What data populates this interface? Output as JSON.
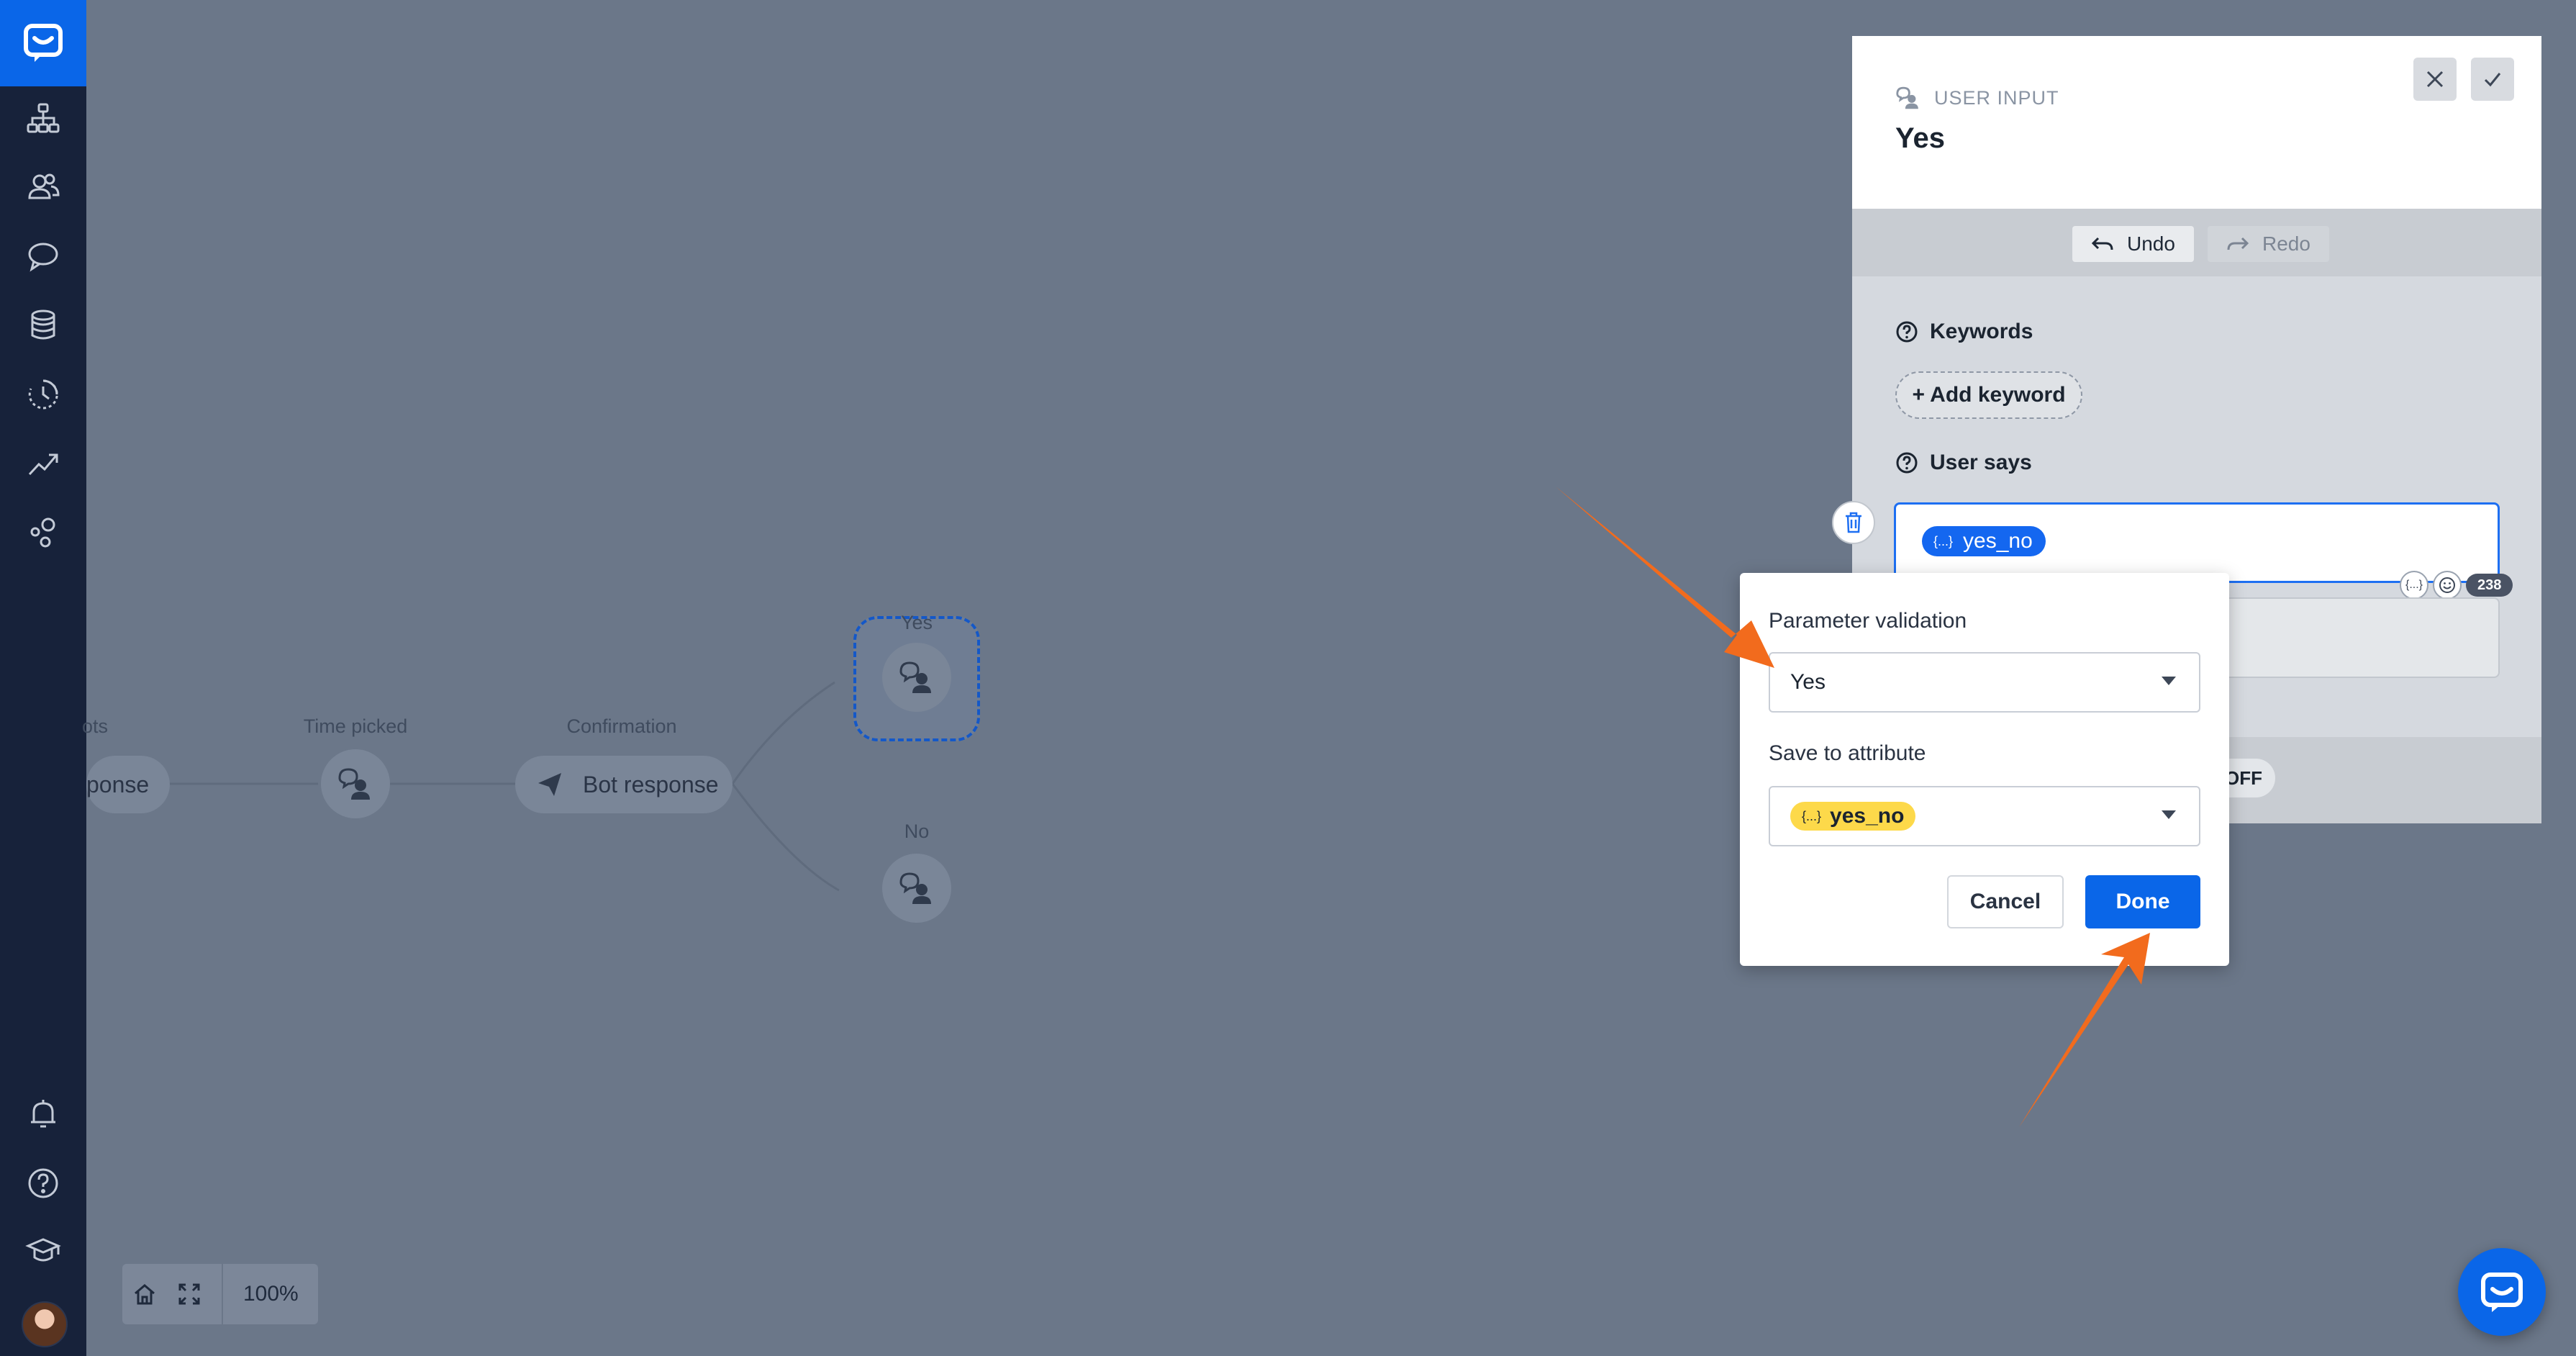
{
  "sidebar": {
    "items": [
      {
        "name": "logo-icon"
      },
      {
        "name": "structure-icon"
      },
      {
        "name": "users-icon"
      },
      {
        "name": "chat-icon"
      },
      {
        "name": "database-icon"
      },
      {
        "name": "history-icon"
      },
      {
        "name": "analytics-icon"
      },
      {
        "name": "integrations-icon"
      },
      {
        "name": "bell-icon"
      },
      {
        "name": "help-icon"
      },
      {
        "name": "academy-icon"
      }
    ]
  },
  "canvas": {
    "nodes": {
      "partial_label": "ots",
      "partial_pill": "ponse",
      "time_picked_label": "Time picked",
      "confirmation_label": "Confirmation",
      "confirmation_pill": "Bot response",
      "yes_label": "Yes",
      "no_label": "No"
    },
    "zoom": {
      "level": "100%"
    }
  },
  "panel": {
    "type_label": "USER INPUT",
    "title": "Yes",
    "undo_label": "Undo",
    "redo_label": "Redo",
    "keywords_label": "Keywords",
    "add_keyword_label": "+ Add keyword",
    "user_says_label": "User says",
    "tag_icon_text": "{...}",
    "user_says_tag": "yes_no",
    "tool_var_text": "{...}",
    "char_count": "238",
    "toggle_label": "OFF"
  },
  "popup": {
    "param_validation_label": "Parameter validation",
    "param_validation_value": "Yes",
    "save_attribute_label": "Save to attribute",
    "tag_icon_text": "{...}",
    "save_attribute_value": "yes_no",
    "cancel_label": "Cancel",
    "done_label": "Done"
  },
  "colors": {
    "accent": "#0a66e8",
    "sidebar_bg": "#17223a",
    "overlay_bg": "#6b7789",
    "annotation_arrow": "#f26b1d",
    "tag_yellow": "#fdd94a"
  }
}
